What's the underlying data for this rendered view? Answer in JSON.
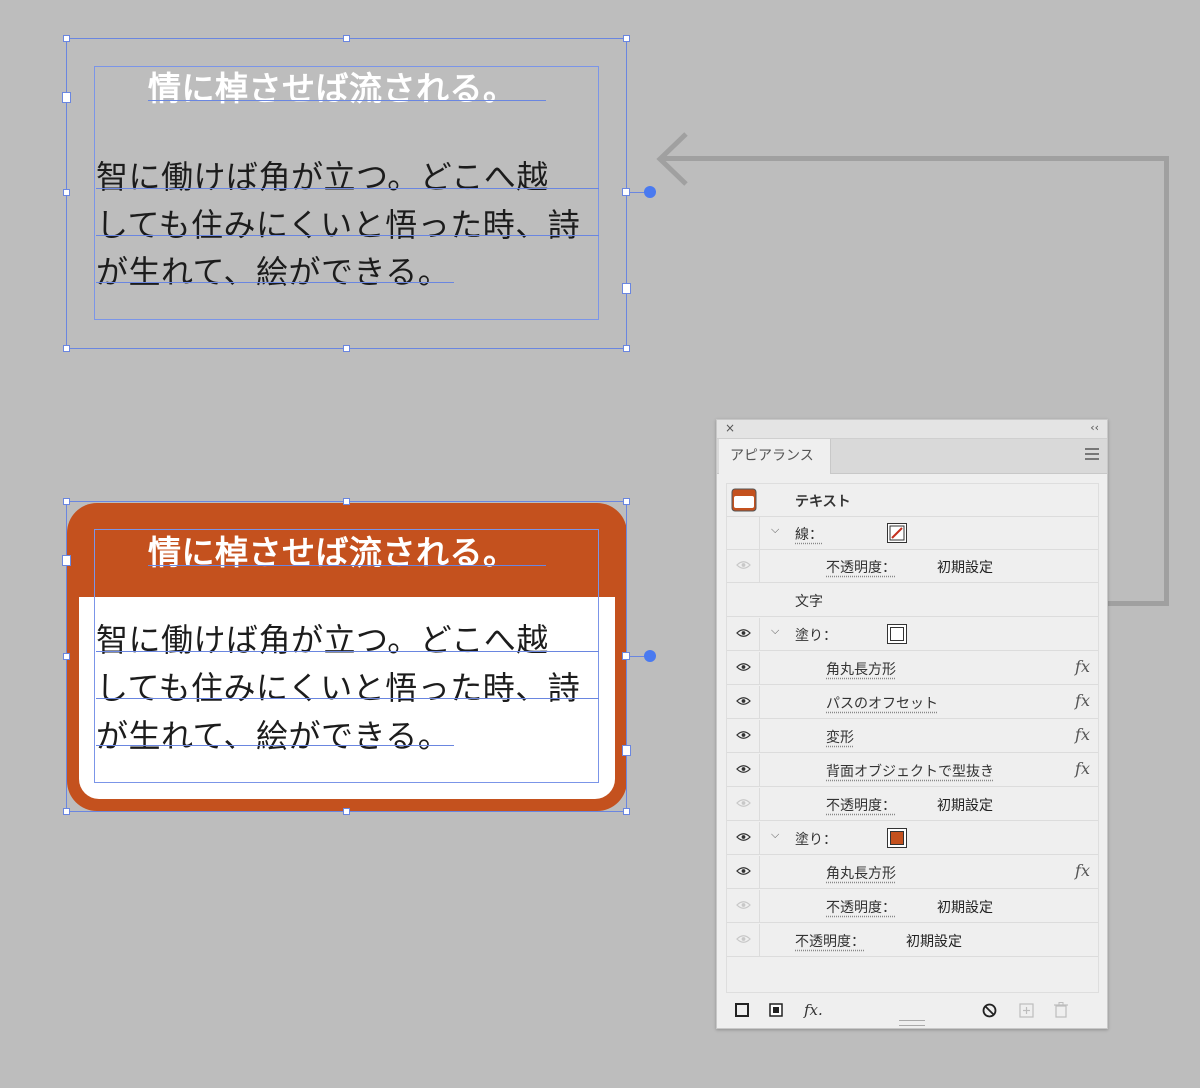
{
  "canvas": {
    "headline": "情に棹させば流される。",
    "body_lines": [
      "智に働けば角が立つ。どこへ越",
      "しても住みにくいと悟った時、詩",
      "が生れて、絵ができる。"
    ],
    "colors": {
      "background": "#bdbdbd",
      "brand_orange": "#c4511e",
      "selection": "#6a86e0"
    }
  },
  "panel": {
    "close_icon": "×",
    "collapse_icon": "‹‹",
    "tab_label": "アピアランス",
    "rows": {
      "text_label": "テキスト",
      "stroke_label": "線：",
      "stroke_opacity_label": "不透明度：",
      "stroke_opacity_value": "初期設定",
      "characters_label": "文字",
      "fill1_label": "塗り：",
      "effect_rounded_rect": "角丸長方形",
      "effect_offset_path": "パスのオフセット",
      "effect_transform": "変形",
      "effect_knockout": "背面オブジェクトで型抜き",
      "fill1_opacity_label": "不透明度：",
      "fill1_opacity_value": "初期設定",
      "fill2_label": "塗り：",
      "fill2_effect": "角丸長方形",
      "fill2_opacity_label": "不透明度：",
      "fill2_opacity_value": "初期設定",
      "object_opacity_label": "不透明度：",
      "object_opacity_value": "初期設定",
      "fx": "fx"
    },
    "footer": {
      "fx_label": "fx."
    }
  }
}
